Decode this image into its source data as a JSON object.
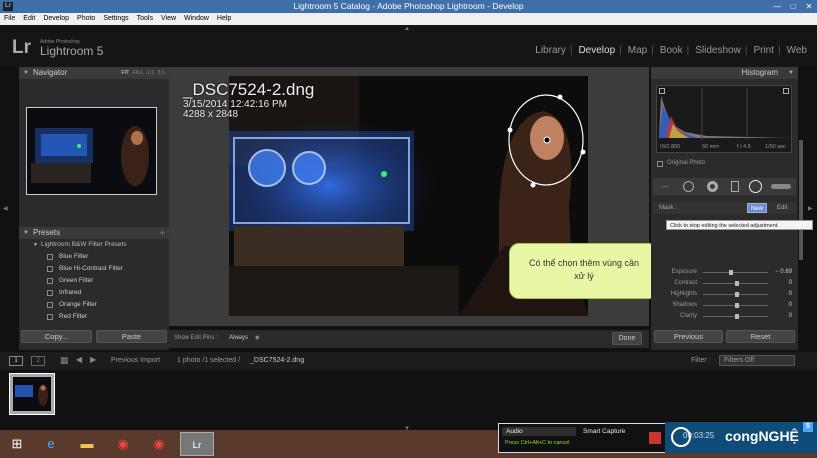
{
  "window": {
    "title": "Lightroom 5 Catalog - Adobe Photoshop Lightroom - Develop",
    "app_icon": "Lr",
    "controls": [
      "—",
      "□",
      "✕"
    ]
  },
  "menu": [
    "File",
    "Edit",
    "Develop",
    "Photo",
    "Settings",
    "Tools",
    "View",
    "Window",
    "Help"
  ],
  "identity": {
    "lr": "Lr",
    "adobe": "Adobe Photoshop",
    "product": "Lightroom 5"
  },
  "modules": [
    {
      "label": "Library",
      "active": false
    },
    {
      "label": "Develop",
      "active": true
    },
    {
      "label": "Map",
      "active": false
    },
    {
      "label": "Book",
      "active": false
    },
    {
      "label": "Slideshow",
      "active": false
    },
    {
      "label": "Print",
      "active": false
    },
    {
      "label": "Web",
      "active": false
    }
  ],
  "navigator": {
    "title": "Navigator",
    "zoom_options": [
      "FIT",
      "FILL",
      "1:1",
      "3:1"
    ]
  },
  "presets": {
    "title": "Presets",
    "add": "+",
    "group": "Lightroom B&W Filter Presets",
    "items": [
      "Blue Filter",
      "Blue Hi-Contrast Filter",
      "Green Filter",
      "Infrared",
      "Orange Filter",
      "Red Filter"
    ]
  },
  "left_buttons": {
    "copy": "Copy...",
    "paste": "Paste"
  },
  "photo_info": {
    "filename": "_DSC7524-2.dng",
    "datetime": "3/15/2014 12:42:16 PM",
    "dimensions": "4288 x 2848"
  },
  "callout": {
    "line1": "Có thể chọn thêm vùng cần",
    "line2": "xử lý"
  },
  "tooltip": "Click to stop editing the selected adjustment.",
  "center_toolbar": {
    "show_edit_pins_label": "Show Edit Pins :",
    "show_edit_pins_value": "Always",
    "done": "Done"
  },
  "histogram": {
    "title": "Histogram",
    "iso": "ISO 800",
    "focal": "50 mm",
    "aperture": "f / 4.5",
    "shutter": "1/50 sec",
    "original_photo": "Original Photo"
  },
  "mask": {
    "label": "Mask :",
    "new": "New",
    "edit": "Edit"
  },
  "sliders": [
    {
      "label": "Exposure",
      "value": "− 0.69",
      "pos": 0.42
    },
    {
      "label": "Contrast",
      "value": "0",
      "pos": 0.5
    },
    {
      "label": "Highlights",
      "value": "0",
      "pos": 0.5
    },
    {
      "label": "Shadows",
      "value": "0",
      "pos": 0.5
    },
    {
      "label": "Clarity",
      "value": "0",
      "pos": 0.5
    }
  ],
  "right_buttons": {
    "previous": "Previous",
    "reset": "Reset"
  },
  "filmbar": {
    "page1": "1",
    "page2": "2",
    "source": "Previous Import",
    "selection": "1 photo /1 selected /",
    "file": "_DSC7524-2.dng",
    "filter_label": "Filter :",
    "filter_value": "Filters Off"
  },
  "recorder": {
    "audio": "Audio",
    "smart_capture": "Smart Capture",
    "hint": "Press Ctrl+Alt+C to cancel",
    "time": "00:03:25"
  },
  "brand": {
    "text": "congNGHỆ",
    "badge": "5"
  },
  "colors": {
    "titlebar": "#3f6fa8",
    "accent_green": "#9bd93b",
    "callout": "#e8f7a4"
  }
}
